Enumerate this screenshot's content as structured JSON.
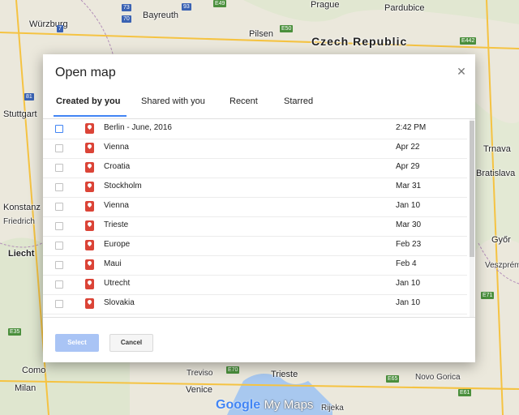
{
  "dialog": {
    "title": "Open map",
    "close_icon": "close-icon",
    "tabs": [
      {
        "label": "Created by you",
        "active": true
      },
      {
        "label": "Shared with you",
        "active": false
      },
      {
        "label": "Recent",
        "active": false
      },
      {
        "label": "Starred",
        "active": false
      }
    ],
    "maps": [
      {
        "name": "Berlin - June, 2016",
        "modified": "2:42 PM"
      },
      {
        "name": "Vienna",
        "modified": "Apr 22"
      },
      {
        "name": "Croatia",
        "modified": "Apr 29"
      },
      {
        "name": "Stockholm",
        "modified": "Mar 31"
      },
      {
        "name": "Vienna",
        "modified": "Jan 10"
      },
      {
        "name": "Trieste",
        "modified": "Mar 30"
      },
      {
        "name": "Europe",
        "modified": "Feb 23"
      },
      {
        "name": "Maui",
        "modified": "Feb 4"
      },
      {
        "name": "Utrecht",
        "modified": "Jan 10"
      },
      {
        "name": "Slovakia",
        "modified": "Jan 10"
      }
    ],
    "select_label": "Select",
    "cancel_label": "Cancel",
    "accent_color": "#4285f4",
    "pin_color": "#db4437"
  },
  "map": {
    "country_label": "Czech Republic",
    "cities": [
      "Würzburg",
      "Bayreuth",
      "Prague",
      "Pardubice",
      "Pilsen",
      "Stuttgart",
      "Konstanz",
      "Friedrich",
      "Liecht",
      "Trnava",
      "Bratislava",
      "Győr",
      "Veszprém",
      "Treviso",
      "Trieste",
      "Venice",
      "Como",
      "Milan",
      "Rijeka",
      "Novo Gorica"
    ],
    "road_shields": [
      "73",
      "70",
      "93",
      "E49",
      "7",
      "E50",
      "E442",
      "81",
      "E35",
      "E70",
      "E65",
      "E71",
      "E61"
    ],
    "logo_google": "Google",
    "logo_suffix": "My Maps"
  }
}
